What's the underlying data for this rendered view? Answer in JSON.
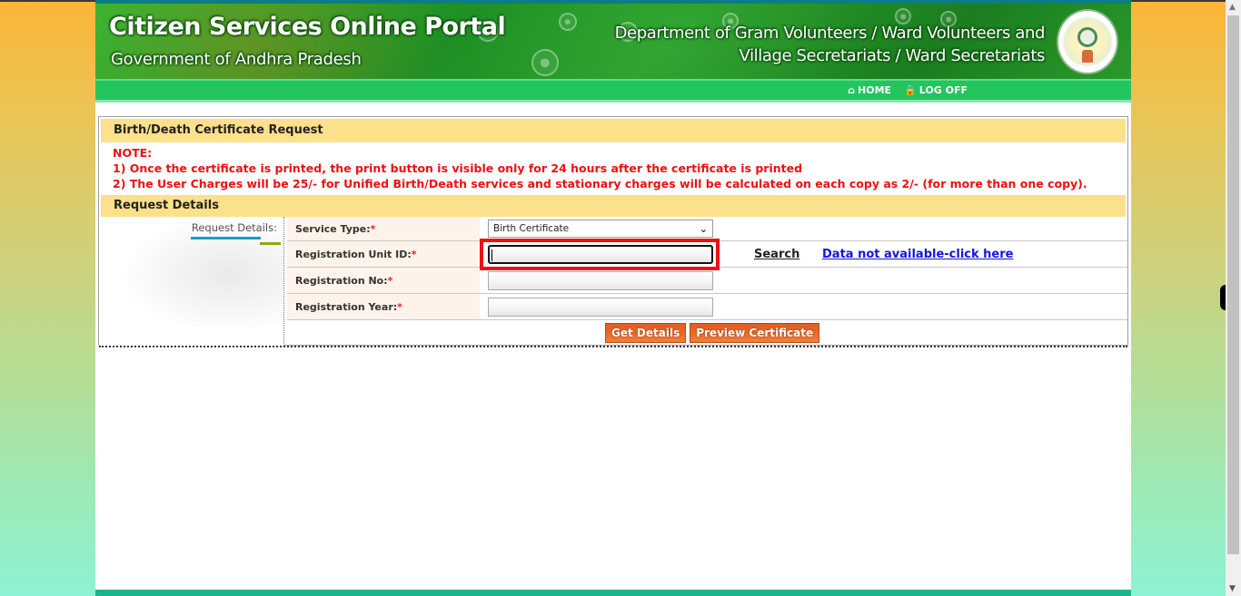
{
  "header": {
    "title": "Citizen Services Online Portal",
    "subtitle": "Government of Andhra Pradesh",
    "department_line1": "Department of Gram Volunteers / Ward Volunteers and",
    "department_line2": "Village Secretariats / Ward Secretariats",
    "emblem_icon": "ap-state-emblem"
  },
  "nav": {
    "items": [
      {
        "label": "HOME",
        "icon": "home-icon"
      },
      {
        "label": "LOG OFF",
        "icon": "lock-icon"
      }
    ]
  },
  "panel": {
    "title": "Birth/Death Certificate Request",
    "note_title": "NOTE:",
    "notes": [
      "1) Once the certificate is printed, the print button is visible only for 24 hours after the certificate is printed",
      "2) The User Charges will be 25/- for Unified Birth/Death services and stationary charges will be calculated on each copy as 2/- (for more than one copy)."
    ],
    "section_title": "Request Details",
    "side_label": "Request Details:"
  },
  "form": {
    "required_marker": "*",
    "fields": [
      {
        "label": "Service Type:",
        "type": "select",
        "value": "Birth Certificate"
      },
      {
        "label": "Registration Unit ID:",
        "type": "text",
        "value": "",
        "focused": true
      },
      {
        "label": "Registration No:",
        "type": "text",
        "value": ""
      },
      {
        "label": "Registration Year:",
        "type": "text",
        "value": ""
      }
    ],
    "search_link": "Search",
    "data_not_available_link": "Data not available-click here",
    "buttons": {
      "get_details": "Get Details",
      "preview_certificate": "Preview Certificate"
    }
  },
  "colors": {
    "accent_green": "#22c55e",
    "panel_header": "#fde08b",
    "note_red": "#f01010",
    "button_orange": "#e8692a",
    "highlight_red": "#ee1111",
    "link_blue": "#1414dd"
  }
}
